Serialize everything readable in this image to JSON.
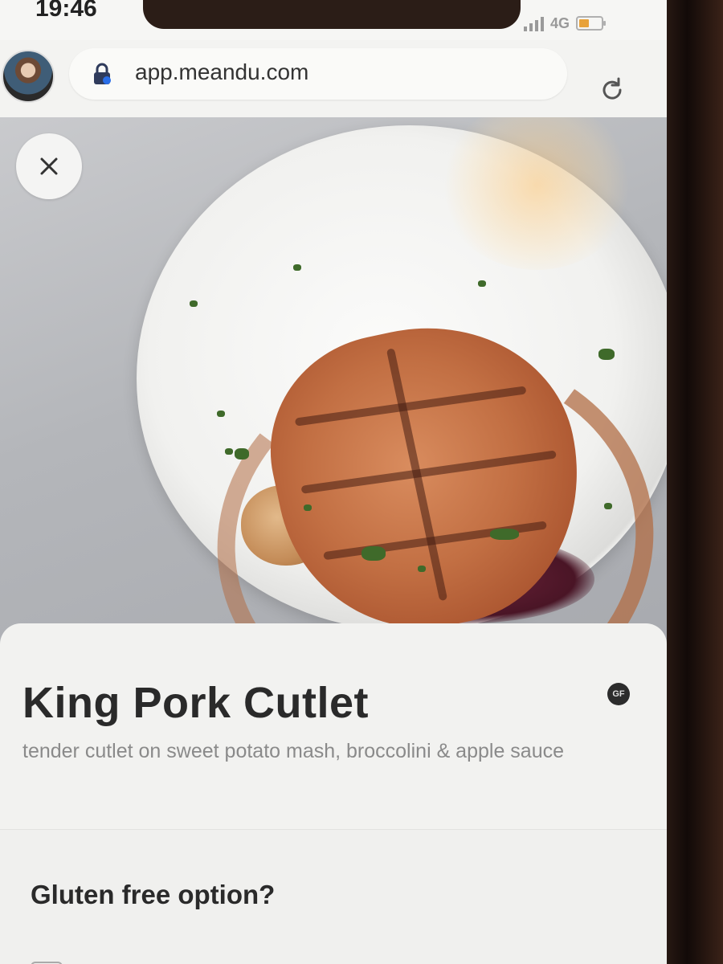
{
  "status_bar": {
    "time": "19:46",
    "network": "4G",
    "battery_color": "#e8a23a"
  },
  "browser": {
    "url": "app.meandu.com",
    "icons": [
      "avatar",
      "lock-icon",
      "reload-icon"
    ]
  },
  "hero": {
    "image": "photo of a grilled pork cutlet on a white plate",
    "close_icon": "close-icon"
  },
  "item": {
    "title": "King Pork Cutlet",
    "badge": "GF",
    "description": "tender cutlet on sweet potato mash, broccolini & apple sauce"
  },
  "options": {
    "heading": "Gluten free option?"
  }
}
